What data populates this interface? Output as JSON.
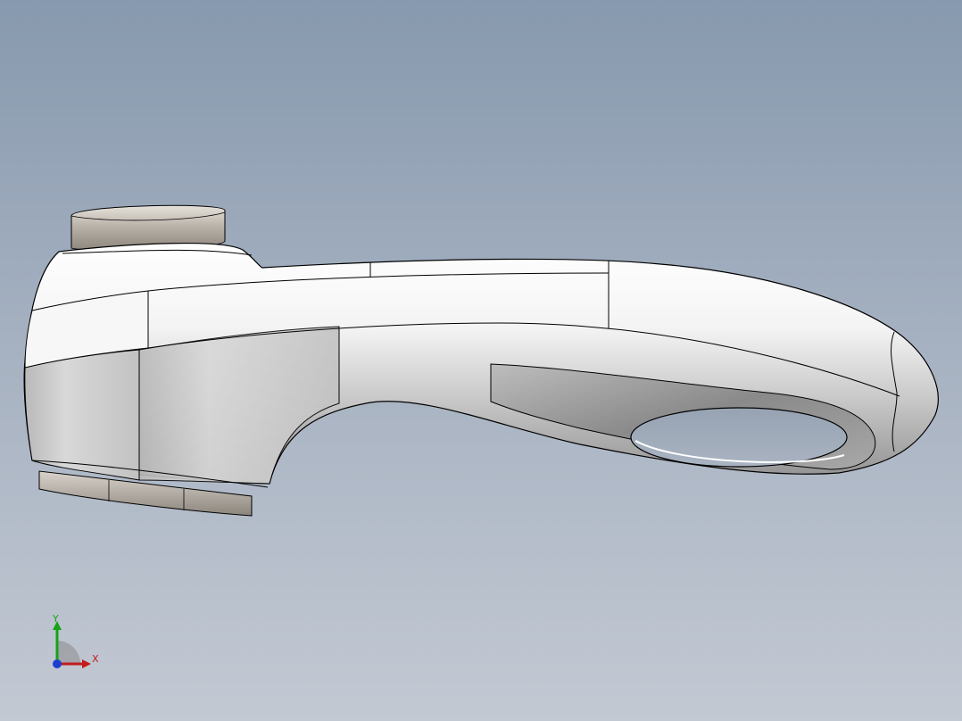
{
  "viewport": {
    "background_top": "#8799ae",
    "background_bottom": "#c3c9d3"
  },
  "model": {
    "part": "faucet-spout-handle",
    "body_color": "#ffffff",
    "shadow_color": "#8c8c8c",
    "edge_color": "#000000",
    "cap_color": "#c9c2b8"
  },
  "triad": {
    "x_label": "X",
    "y_label": "Y",
    "x_color": "#c21c1c",
    "y_color": "#15a315",
    "z_color": "#1d3fd1"
  }
}
